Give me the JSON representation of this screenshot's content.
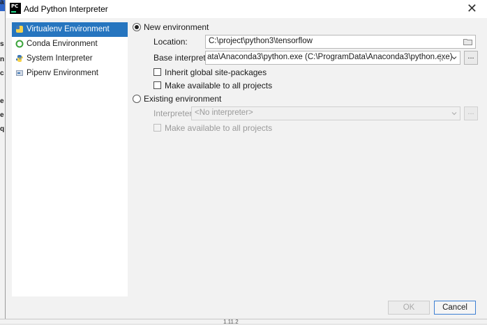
{
  "background": {
    "left_fragments": [
      "a",
      "s",
      "n",
      "e",
      "c",
      ":",
      "e",
      "q"
    ],
    "bottom_text": "1.11.2"
  },
  "dialog": {
    "title": "Add Python Interpreter",
    "app_icon_text": "PC",
    "close_icon": "close-icon"
  },
  "sidebar": {
    "items": [
      {
        "label": "Virtualenv Environment",
        "icon": "virtualenv-icon",
        "selected": true
      },
      {
        "label": "Conda Environment",
        "icon": "conda-icon",
        "selected": false
      },
      {
        "label": "System Interpreter",
        "icon": "python-icon",
        "selected": false
      },
      {
        "label": "Pipenv Environment",
        "icon": "pipenv-icon",
        "selected": false
      }
    ]
  },
  "new_env": {
    "label": "New environment",
    "selected": true,
    "location_label": "Location:",
    "location_value": "C:\\project\\python3\\tensorflow",
    "base_label": "Base interpreter:",
    "base_value": "ata\\Anaconda3\\python.exe (C:\\ProgramData\\Anaconda3\\python.exe)",
    "inherit_label": "Inherit global site-packages",
    "inherit_checked": false,
    "available_label": "Make available to all projects",
    "available_checked": false,
    "browse_label": "..."
  },
  "existing_env": {
    "label": "Existing environment",
    "selected": false,
    "interpreter_label": "Interpreter:",
    "interpreter_value": "<No interpreter>",
    "available_label": "Make available to all projects",
    "browse_label": "..."
  },
  "footer": {
    "ok_label": "OK",
    "cancel_label": "Cancel"
  },
  "colors": {
    "selection": "#2675bf",
    "dialog_bg": "#f2f2f2",
    "focus_border": "#3c7fd3"
  }
}
